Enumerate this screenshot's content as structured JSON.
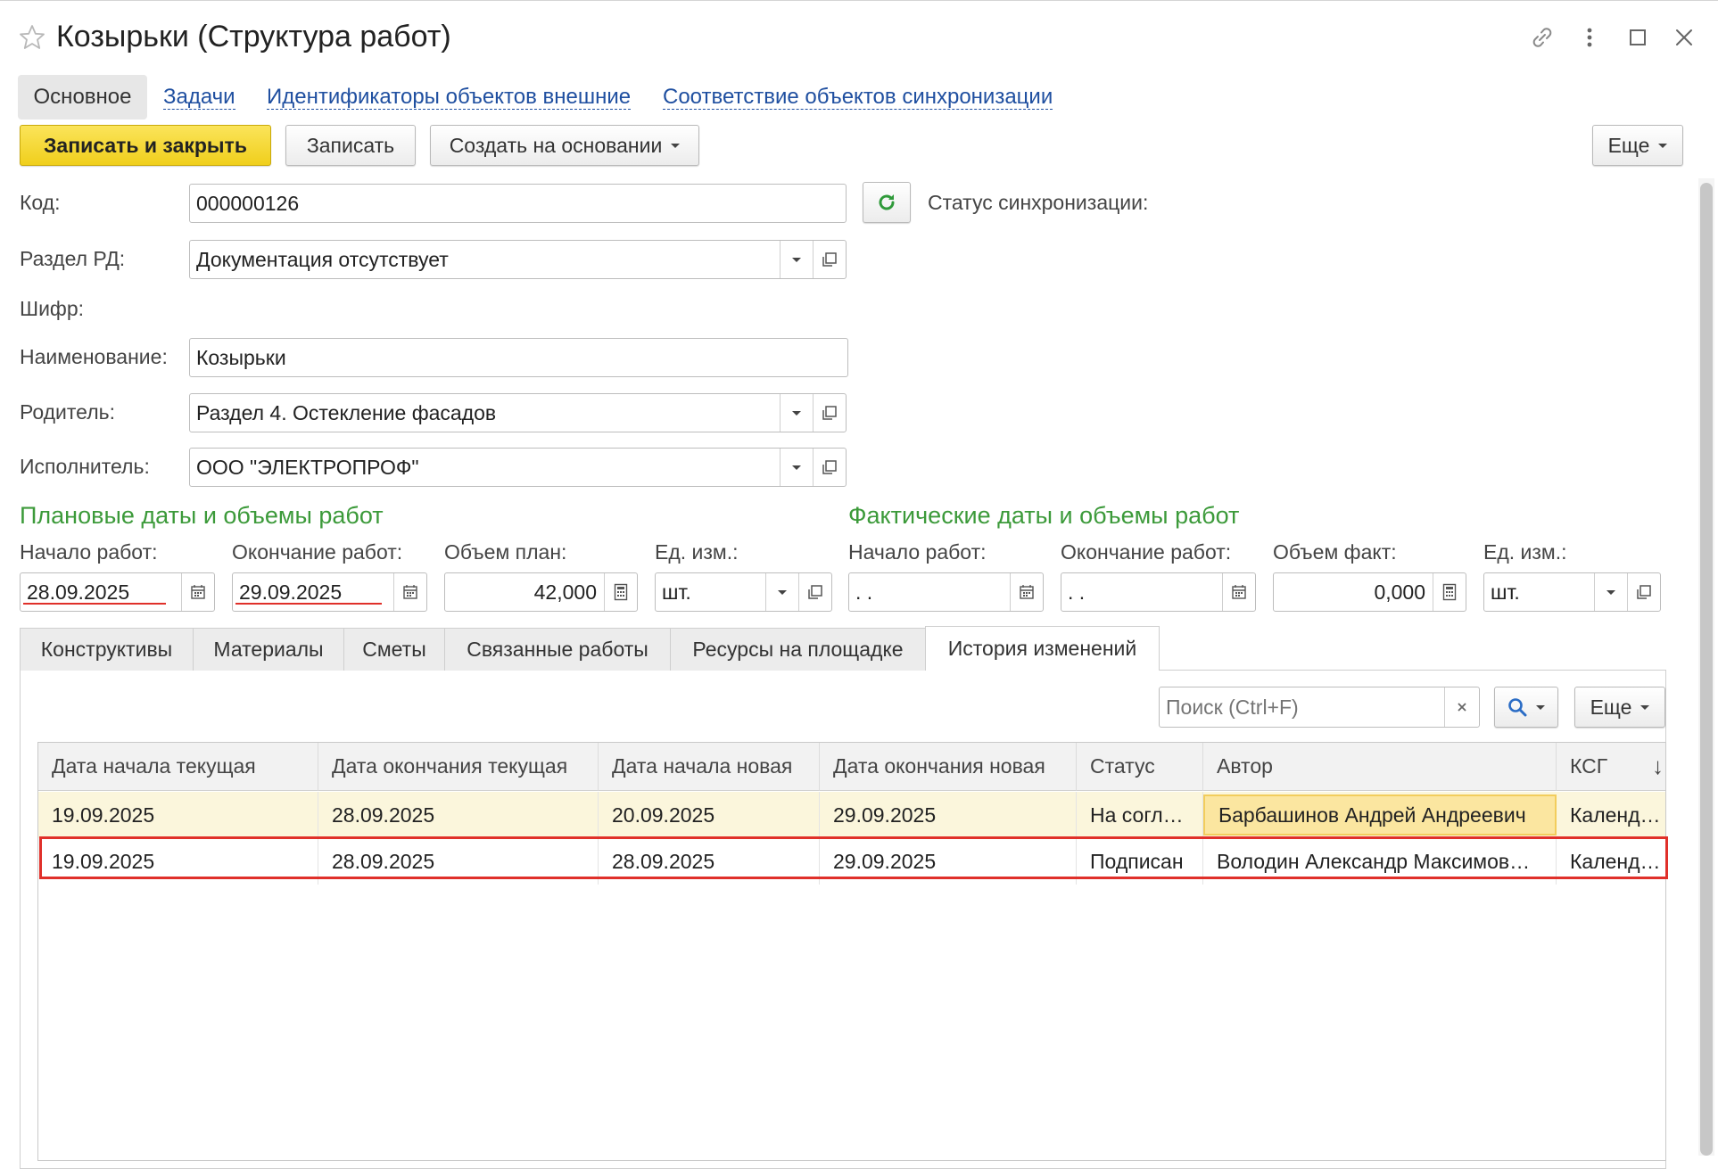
{
  "window": {
    "title": "Козырьки (Структура работ)"
  },
  "nav_tabs": [
    "Основное",
    "Задачи",
    "Идентификаторы объектов внешние",
    "Соответствие объектов синхронизации"
  ],
  "toolbar": {
    "save_close": "Записать и закрыть",
    "save": "Записать",
    "create_based": "Создать на основании",
    "more": "Еще"
  },
  "form": {
    "code_label": "Код:",
    "code_value": "000000126",
    "sync_status_label": "Статус синхронизации:",
    "rd_label": "Раздел РД:",
    "rd_value": "Документация отсутствует",
    "cipher_label": "Шифр:",
    "name_label": "Наименование:",
    "name_value": "Козырьки",
    "parent_label": "Родитель:",
    "parent_value": "Раздел 4. Остекление фасадов",
    "executor_label": "Исполнитель:",
    "executor_value": "ООО \"ЭЛЕКТРОПРОФ\""
  },
  "plan": {
    "title": "Плановые даты и объемы работ",
    "start_label": "Начало работ:",
    "start_value": "28.09.2025",
    "end_label": "Окончание работ:",
    "end_value": "29.09.2025",
    "volume_label": "Объем план:",
    "volume_value": "42,000",
    "unit_label": "Ед. изм.:",
    "unit_value": "шт."
  },
  "fact": {
    "title": "Фактические даты и объемы работ",
    "start_label": "Начало работ:",
    "start_value": " .  .",
    "end_label": "Окончание работ:",
    "end_value": " .  .",
    "volume_label": "Объем факт:",
    "volume_value": "0,000",
    "unit_label": "Ед. изм.:",
    "unit_value": "шт."
  },
  "tabs": [
    "Конструктивы",
    "Материалы",
    "Сметы",
    "Связанные работы",
    "Ресурсы на площадке",
    "История изменений"
  ],
  "history": {
    "search_placeholder": "Поиск (Ctrl+F)",
    "more": "Еще",
    "columns": [
      "Дата начала текущая",
      "Дата окончания текущая",
      "Дата начала новая",
      "Дата окончания новая",
      "Статус",
      "Автор",
      "КСГ"
    ],
    "sort_indicator": "↓",
    "rows": [
      [
        "19.09.2025",
        "28.09.2025",
        "20.09.2025",
        "29.09.2025",
        "На согл…",
        "Барбашинов Андрей Андреевич",
        "Календ…"
      ],
      [
        "19.09.2025",
        "28.09.2025",
        "28.09.2025",
        "29.09.2025",
        "Подписан",
        "Володин Александр Максимов…",
        "Календ…"
      ]
    ]
  },
  "colors": {
    "accent_green": "#3c9a3a",
    "link_blue": "#1f4fa0",
    "primary_button": "#f5d628",
    "highlight_row": "#fbf6dc",
    "annotation_red": "#e0302a"
  }
}
